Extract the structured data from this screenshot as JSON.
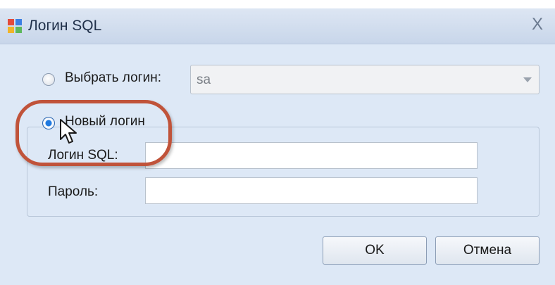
{
  "window": {
    "title": "Логин SQL",
    "close_glyph": "X"
  },
  "choose_login": {
    "label": "Выбрать логин:",
    "value": "sa",
    "selected": false
  },
  "new_login": {
    "label": "Новый логин",
    "selected": true
  },
  "fields": {
    "login_label": "Логин SQL:",
    "login_value": "",
    "password_label": "Пароль:",
    "password_value": ""
  },
  "buttons": {
    "ok": "OK",
    "cancel": "Отмена"
  },
  "colors": {
    "accent": "#1f79e0",
    "highlight": "#c0533a",
    "background": "#dde8f6"
  }
}
